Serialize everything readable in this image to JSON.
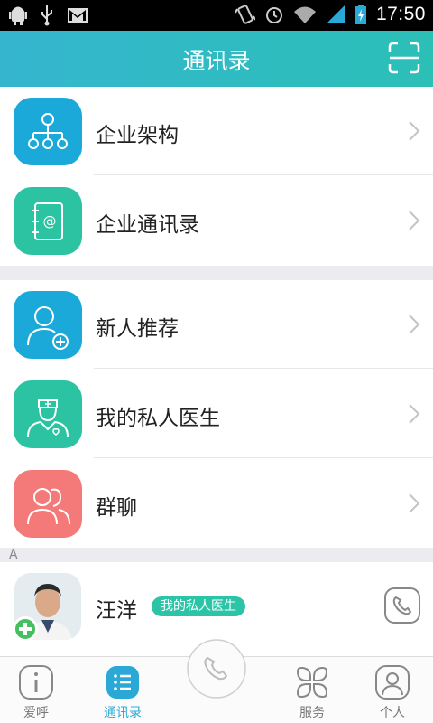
{
  "status_bar": {
    "time": "17:50"
  },
  "header": {
    "title": "通讯录"
  },
  "menu_group_1": [
    {
      "label": "企业架构",
      "color": "#1aa9d8"
    },
    {
      "label": "企业通讯录",
      "color": "#2bc3a1"
    }
  ],
  "menu_group_2": [
    {
      "label": "新人推荐",
      "color": "#1aa9d8"
    },
    {
      "label": "我的私人医生",
      "color": "#2bc3a1"
    },
    {
      "label": "群聊",
      "color": "#f47a7a"
    }
  ],
  "section_index": "A",
  "contact": {
    "name": "汪洋",
    "badge": "我的私人医生"
  },
  "tabs": [
    {
      "label": "爱呼"
    },
    {
      "label": "通讯录",
      "active": true
    },
    {
      "label": "服务"
    },
    {
      "label": "个人"
    }
  ],
  "colors": {
    "accent": "#2ba9d6",
    "header_start": "#35b6cf",
    "header_end": "#2bbfb6",
    "badge": "#2bc4a6"
  }
}
